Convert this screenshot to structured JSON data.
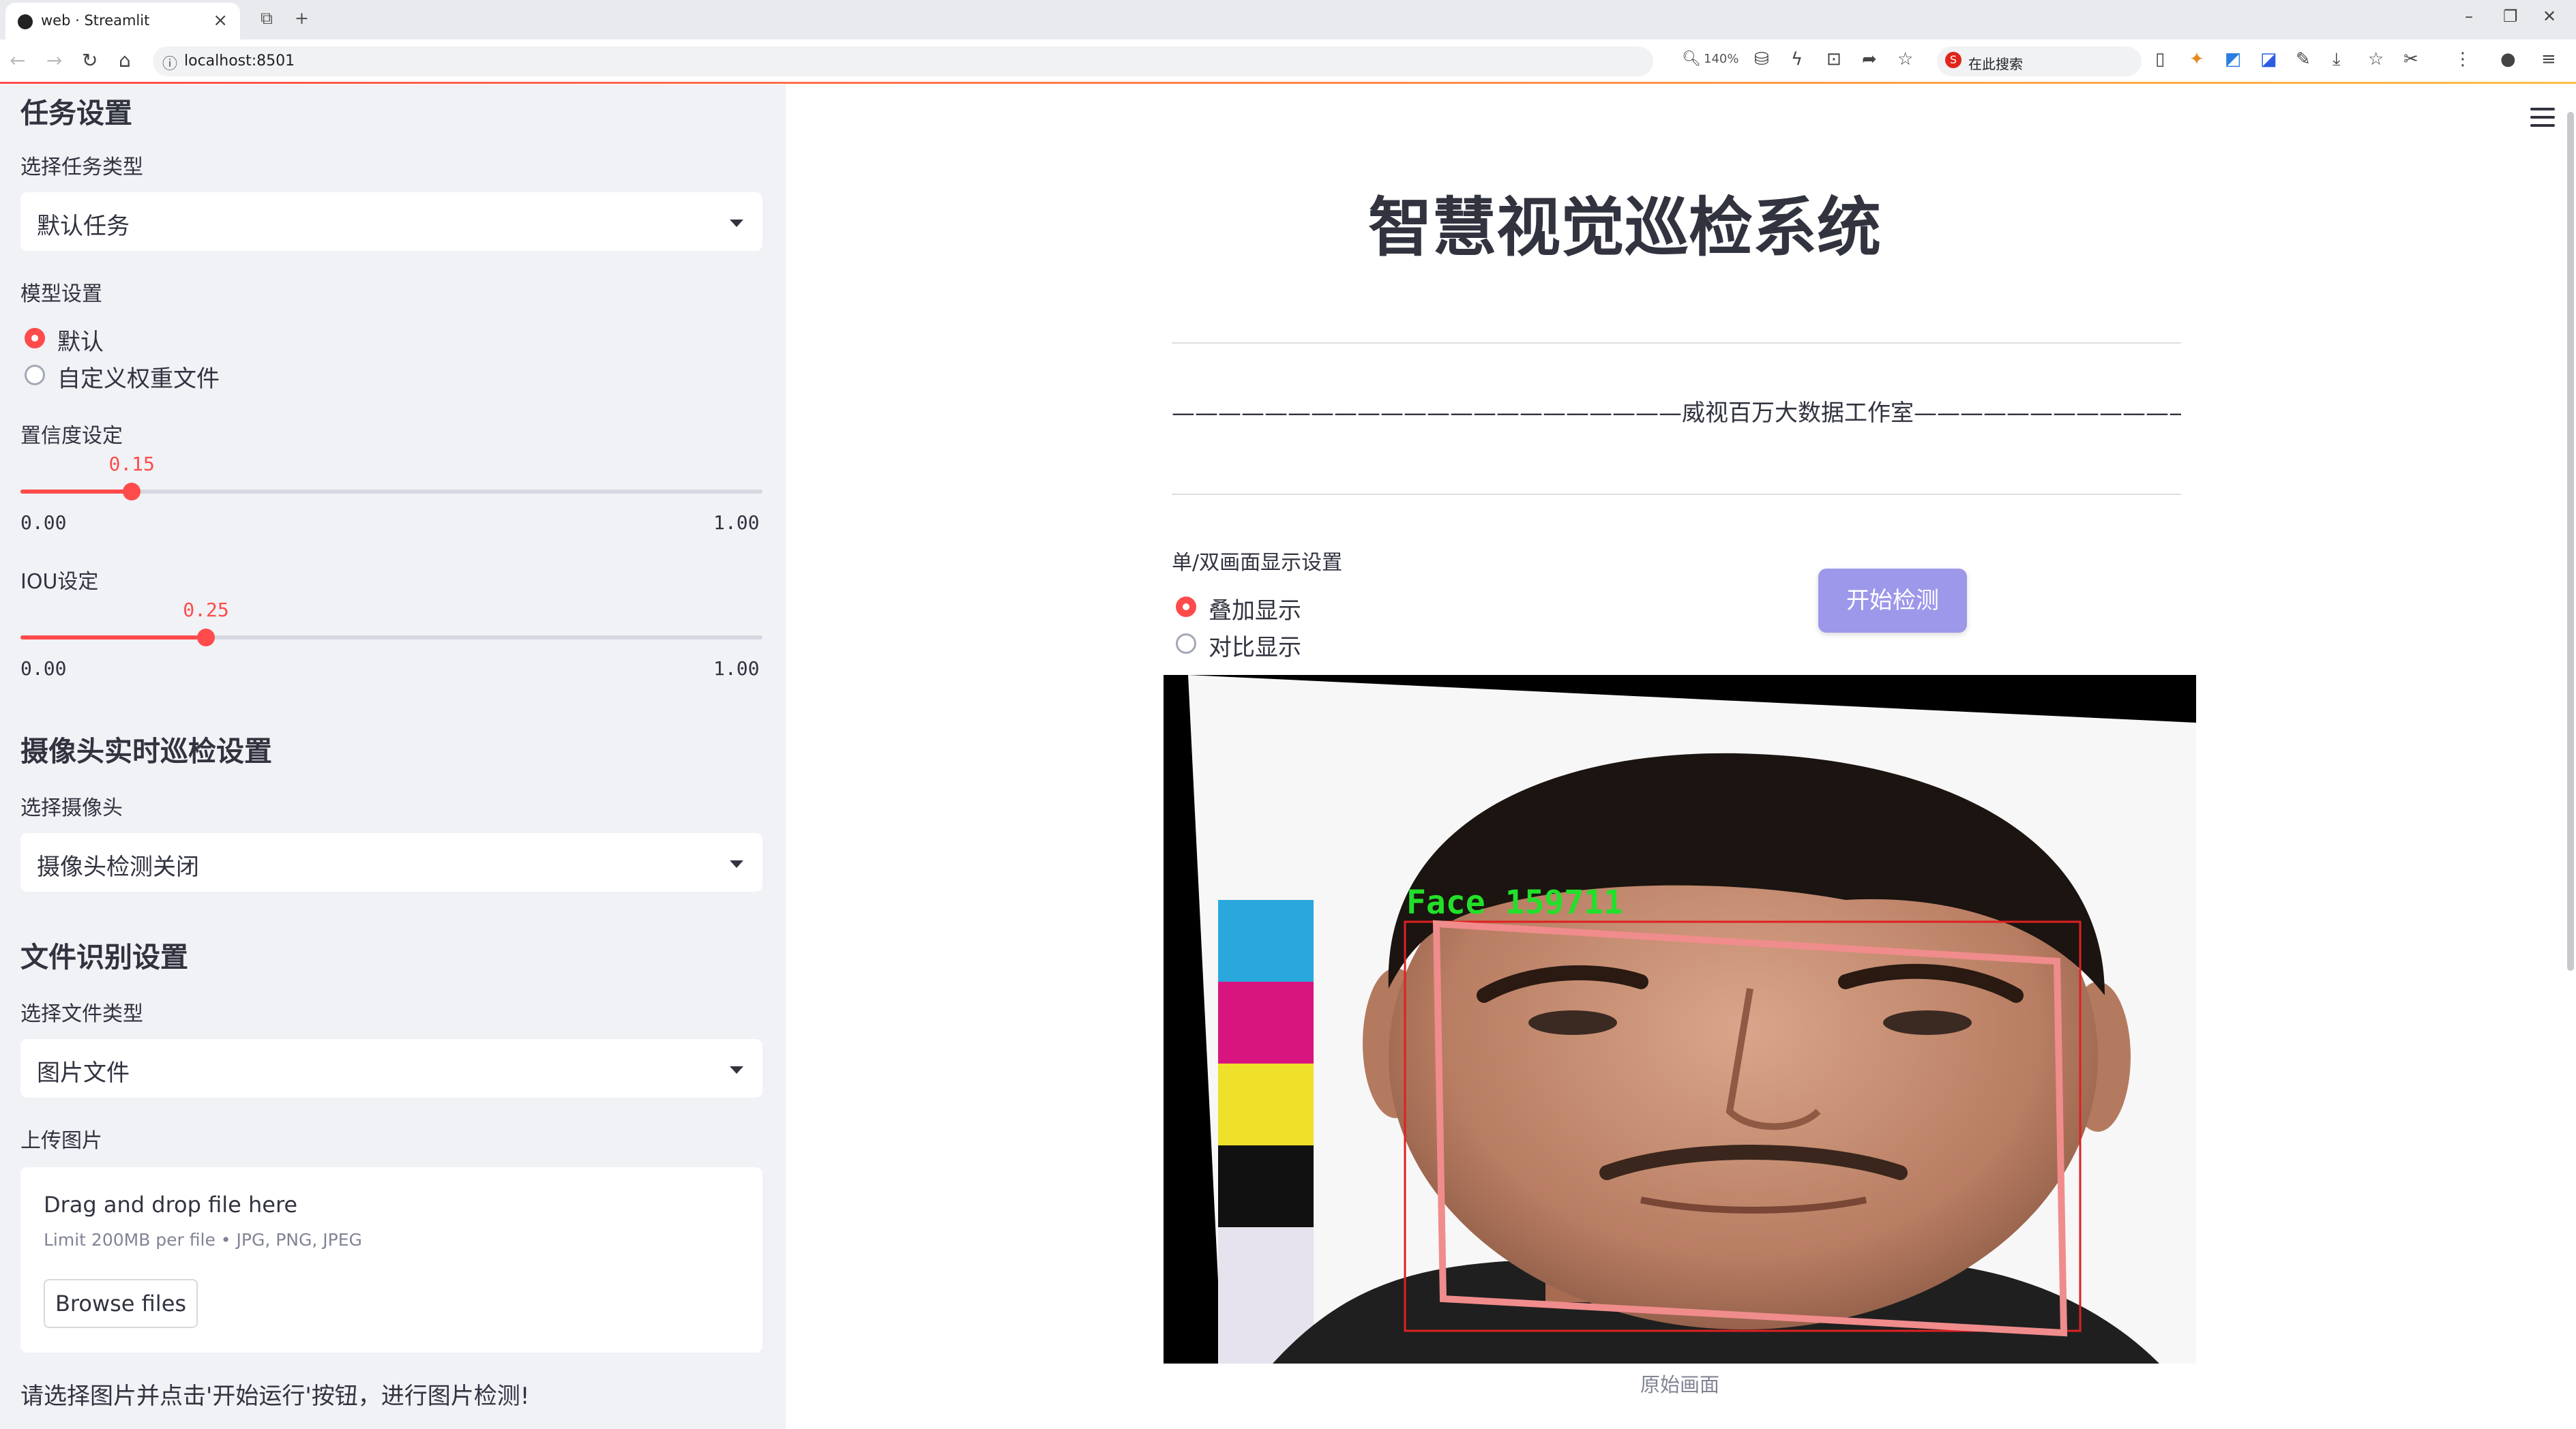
{
  "browser": {
    "tab_title": "web · Streamlit",
    "url": "localhost:8501",
    "zoom": "140%",
    "search_placeholder": "在此搜索"
  },
  "sidebar": {
    "task_section_title": "任务设置",
    "task_type_label": "选择任务类型",
    "task_type_value": "默认任务",
    "model_label": "模型设置",
    "model_options": [
      "默认",
      "自定义权重文件"
    ],
    "model_selected": "默认",
    "confidence_label": "置信度设定",
    "confidence": {
      "value": 0.15,
      "value_text": "0.15",
      "min": "0.00",
      "max": "1.00"
    },
    "iou_label": "IOU设定",
    "iou": {
      "value": 0.25,
      "value_text": "0.25",
      "min": "0.00",
      "max": "1.00"
    },
    "camera_section_title": "摄像头实时巡检设置",
    "camera_label": "选择摄像头",
    "camera_value": "摄像头检测关闭",
    "file_section_title": "文件识别设置",
    "file_type_label": "选择文件类型",
    "file_type_value": "图片文件",
    "upload_label": "上传图片",
    "upload": {
      "title": "Drag and drop file here",
      "limit": "Limit 200MB per file • JPG, PNG, JPEG",
      "browse_label": "Browse files"
    },
    "hint": "请选择图片并点击'开始运行'按钮，进行图片检测!"
  },
  "main": {
    "title": "智慧视觉巡检系统",
    "studio_line": "——————————————————————威视百万大数据工作室———————————————————————",
    "display_mode_label": "单/双画面显示设置",
    "display_options": [
      "叠加显示",
      "对比显示"
    ],
    "display_selected": "叠加显示",
    "start_button": "开始检测",
    "detection_label": "Face 159711",
    "caption": "原始画面"
  },
  "colors": {
    "accent": "#ff4b4b",
    "start_button": "#9d98ea",
    "detection_label": "#22e02a",
    "detection_box": "#f08c8c"
  }
}
